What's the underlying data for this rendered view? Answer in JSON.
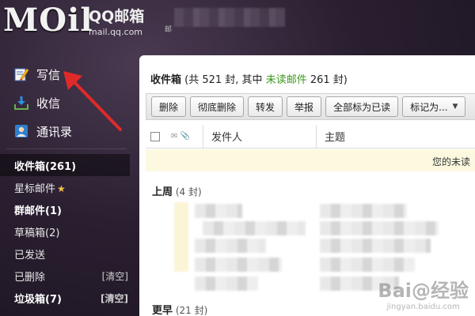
{
  "header": {
    "logo": "MOil",
    "brand": "QQ邮箱",
    "domain": "mail.qq.com",
    "tag": "邮"
  },
  "sidebar": {
    "actions": [
      {
        "label": "写信",
        "icon": "compose-icon"
      },
      {
        "label": "收信",
        "icon": "inbox-download-icon"
      },
      {
        "label": "通讯录",
        "icon": "contacts-icon"
      }
    ],
    "folders": [
      {
        "label": "收件箱(261)",
        "clear": ""
      },
      {
        "label": "星标邮件",
        "clear": ""
      },
      {
        "label": "群邮件(1)",
        "clear": ""
      },
      {
        "label": "草稿箱(2)",
        "clear": ""
      },
      {
        "label": "已发送",
        "clear": ""
      },
      {
        "label": "已删除",
        "clear": "[清空]"
      },
      {
        "label": "垃圾箱(7)",
        "clear": "[清空]"
      }
    ]
  },
  "main": {
    "title": "收件箱",
    "summary_prefix": " (共 521 封, 其中 ",
    "unread_label": "未读邮件",
    "summary_suffix": " 261 封)",
    "toolbar": [
      "删除",
      "彻底删除",
      "转发",
      "举报",
      "全部标为已读",
      "标记为..."
    ],
    "columns": {
      "sender": "发件人",
      "subject": "主题"
    },
    "notice": "您的未读",
    "groups": [
      {
        "title": "上周",
        "count": " (4 封)"
      },
      {
        "title": "更早",
        "count": " (21 封)"
      }
    ]
  },
  "watermark": {
    "logo": "Bai@经验",
    "url": "jingyan.baidu.com"
  },
  "colors": {
    "unread_green": "#3a9a1a",
    "arrow_red": "#e02a2a",
    "star_yellow": "#f6c443"
  }
}
